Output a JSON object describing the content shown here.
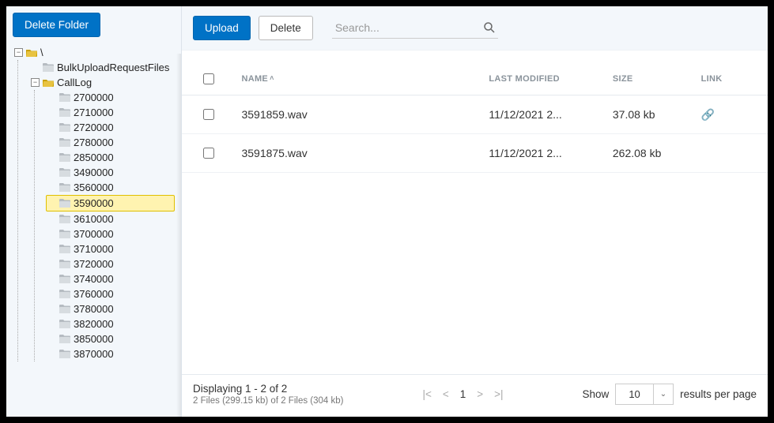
{
  "sidebar": {
    "deleteFolder": "Delete Folder",
    "root": "\\",
    "tree": [
      {
        "label": "BulkUploadRequestFiles"
      },
      {
        "label": "CallLog",
        "open": true,
        "children": [
          {
            "label": "2700000"
          },
          {
            "label": "2710000"
          },
          {
            "label": "2720000"
          },
          {
            "label": "2780000"
          },
          {
            "label": "2850000"
          },
          {
            "label": "3490000"
          },
          {
            "label": "3560000"
          },
          {
            "label": "3590000",
            "selected": true
          },
          {
            "label": "3610000"
          },
          {
            "label": "3700000"
          },
          {
            "label": "3710000"
          },
          {
            "label": "3720000"
          },
          {
            "label": "3740000"
          },
          {
            "label": "3760000"
          },
          {
            "label": "3780000"
          },
          {
            "label": "3820000"
          },
          {
            "label": "3850000"
          },
          {
            "label": "3870000"
          }
        ]
      }
    ]
  },
  "toolbar": {
    "upload": "Upload",
    "delete": "Delete",
    "searchPlaceholder": "Search..."
  },
  "table": {
    "headers": {
      "name": "NAME",
      "lastModified": "LAST MODIFIED",
      "size": "SIZE",
      "link": "LINK"
    },
    "rows": [
      {
        "name": "3591859.wav",
        "modified": "11/12/2021 2...",
        "size": "37.08 kb",
        "hasLink": true
      },
      {
        "name": "3591875.wav",
        "modified": "11/12/2021 2...",
        "size": "262.08 kb",
        "hasLink": false
      }
    ]
  },
  "footer": {
    "displaying": "Displaying 1 - 2 of 2",
    "subtext": "2 Files (299.15 kb) of 2 Files (304 kb)",
    "page": "1",
    "showLabel": "Show",
    "pageSize": "10",
    "resultsLabel": "results per page"
  }
}
